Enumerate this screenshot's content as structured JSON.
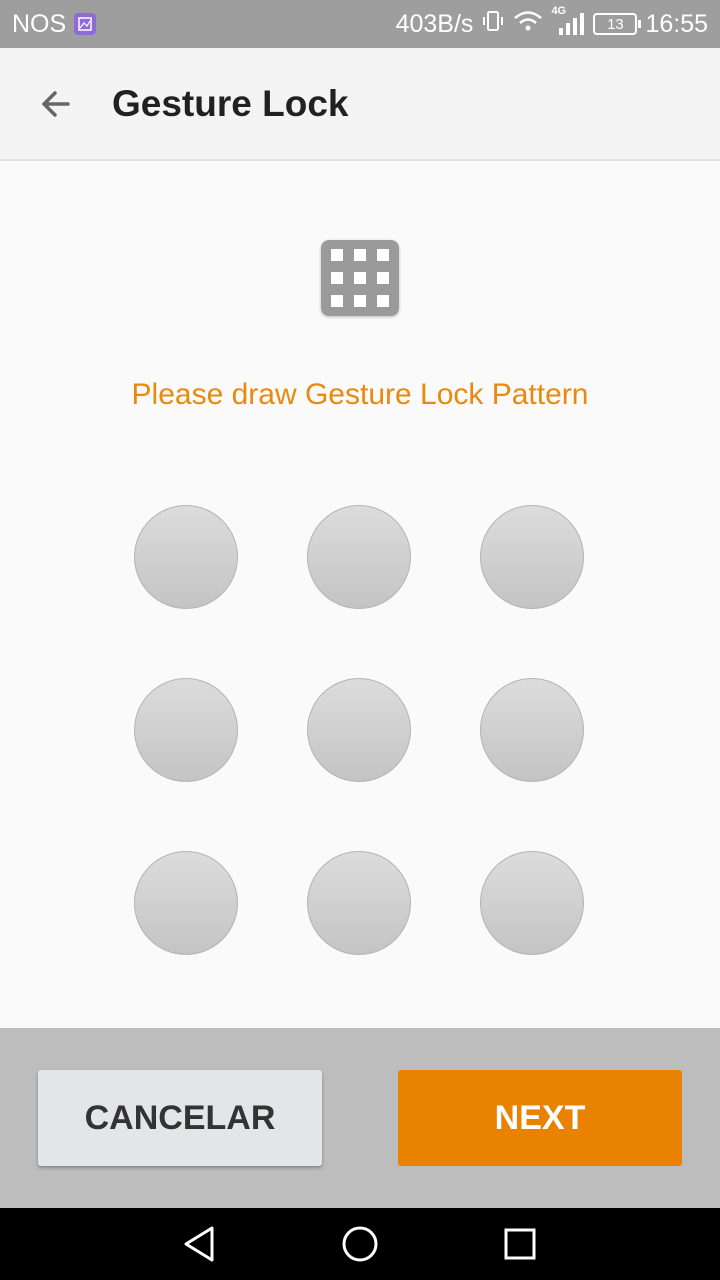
{
  "status_bar": {
    "carrier": "NOS",
    "net_speed": "403B/s",
    "network_type": "4G",
    "battery": "13",
    "time": "16:55"
  },
  "app_bar": {
    "back_icon": "arrow-left-icon",
    "title": "Gesture Lock"
  },
  "header_icon": "grid-dots-icon",
  "instruction": "Please draw Gesture Lock Pattern",
  "pattern": {
    "rows": 3,
    "cols": 3,
    "selected": []
  },
  "buttons": {
    "cancel_label": "CANCELAR",
    "next_label": "NEXT"
  },
  "colors": {
    "accent": "#e88200",
    "instruction_text": "#e88a10"
  },
  "nav_bar": {
    "back_icon": "triangle-back-icon",
    "home_icon": "circle-home-icon",
    "recents_icon": "square-recents-icon"
  }
}
